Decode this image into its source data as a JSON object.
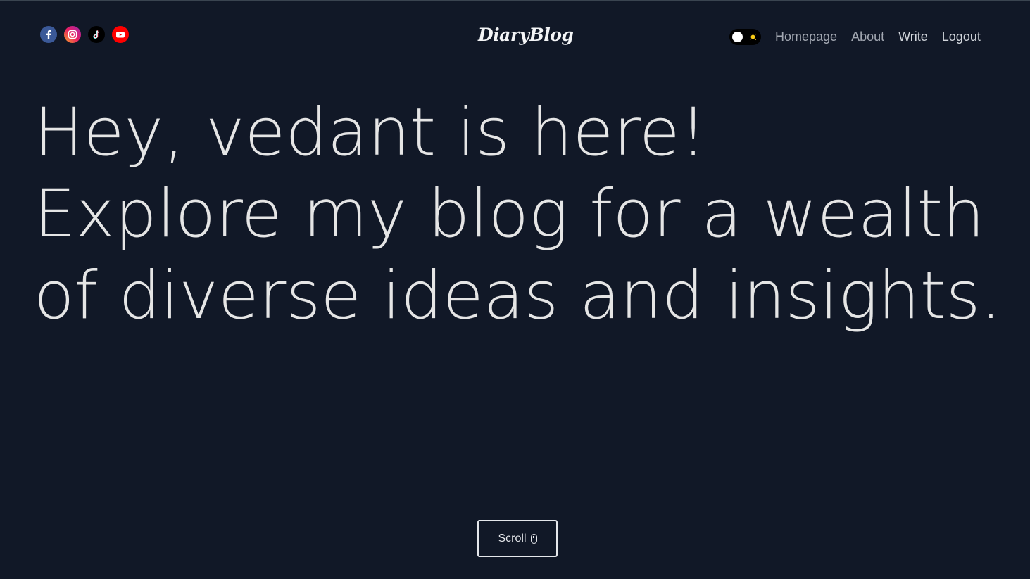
{
  "header": {
    "social_links": [
      {
        "name": "facebook",
        "icon": "facebook-icon",
        "color": "#3b5998"
      },
      {
        "name": "instagram",
        "icon": "instagram-icon",
        "color": "#e91e63"
      },
      {
        "name": "tiktok",
        "icon": "tiktok-icon",
        "color": "#000000"
      },
      {
        "name": "youtube",
        "icon": "youtube-icon",
        "color": "#ff0000"
      }
    ],
    "logo": "DiaryBlog",
    "theme_toggle": {
      "state": "dark",
      "icon": "sun-icon"
    },
    "nav": {
      "homepage": "Homepage",
      "about": "About",
      "write": "Write",
      "logout": "Logout"
    }
  },
  "hero": {
    "line1": "Hey, vedant is here!",
    "line2": "Explore my blog for a wealth",
    "line3": "of diverse ideas and insights."
  },
  "scroll_button": {
    "label": "Scroll",
    "icon": "mouse-icon"
  },
  "colors": {
    "background": "#111827",
    "text": "#e5e5e5",
    "nav_text": "#a3a8b2"
  }
}
